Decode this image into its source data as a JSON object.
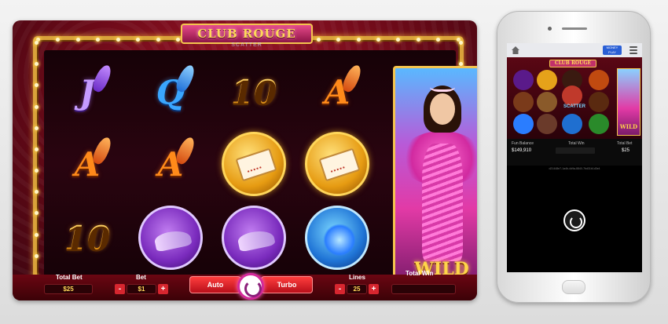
{
  "desktop": {
    "logo": "CLUB ROUGE",
    "subtitle": "SCATTER",
    "wild_label": "WILD",
    "reels": {
      "row1": [
        "J",
        "Q",
        "10",
        "A"
      ],
      "row2": [
        "A",
        "A",
        "ticket-coin",
        "ticket-coin"
      ],
      "row3": [
        "10",
        "shoe-disc",
        "shoe-disc",
        "feather-disc"
      ]
    },
    "controls": {
      "total_bet_label": "Total Bet",
      "total_bet_value": "$25",
      "bet_label": "Bet",
      "bet_value": "$1",
      "minus": "-",
      "plus": "+",
      "auto_label": "Auto",
      "turbo_label": "Turbo",
      "lines_label": "Lines",
      "lines_value": "25",
      "total_win_label": "Total Win",
      "total_win_value": ""
    },
    "colors": {
      "primary_red": "#6b0a18",
      "gold": "#f4c44e",
      "button_red": "#d7262f",
      "spin_pink": "#d42a9a"
    }
  },
  "mobile": {
    "demo_button": "MONEY\nPLAY",
    "logo": "CLUB ROUGE",
    "scatter": "SCATTER",
    "wild": "WILD",
    "fun_balance_label": "Fun Balance",
    "fun_balance_value": "$149,910",
    "total_win_label": "Total Win",
    "total_bet_label": "Total Bet",
    "total_bet_value": "$25",
    "round_id": "d21448e7-1a4b-4d9a-8840-7bd31b1d3e4"
  }
}
